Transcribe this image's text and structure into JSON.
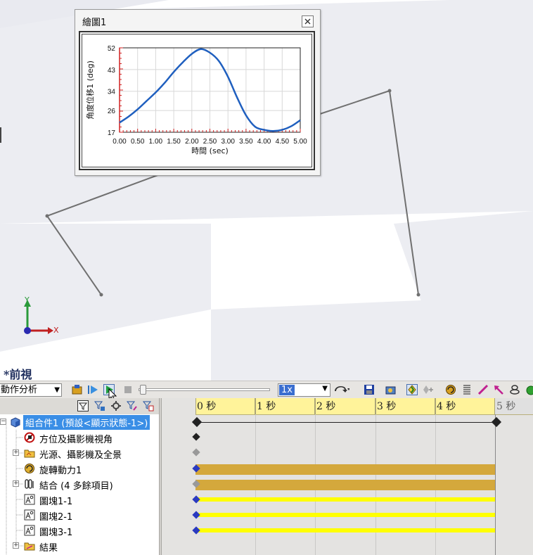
{
  "viewport": {
    "view_label": "*前視"
  },
  "triad": {
    "x_label": "X",
    "y_label": "Y"
  },
  "plot_window": {
    "title": "繪圖1",
    "close_icon": "close-icon"
  },
  "chart_data": {
    "type": "line",
    "title": "",
    "xlabel": "時間 (sec)",
    "ylabel": "角度位移1 (deg)",
    "xlim": [
      0,
      5
    ],
    "ylim": [
      17,
      52
    ],
    "x_ticks": [
      "0.00",
      "0.50",
      "1.00",
      "1.50",
      "2.00",
      "2.50",
      "3.00",
      "3.50",
      "4.00",
      "4.50",
      "5.00"
    ],
    "y_ticks": [
      "52",
      "43",
      "34",
      "26",
      "17"
    ],
    "grid": true,
    "series": [
      {
        "color": "#1f5fbf",
        "x": [
          0.0,
          0.25,
          0.5,
          0.75,
          1.0,
          1.25,
          1.5,
          1.75,
          2.0,
          2.25,
          2.5,
          2.75,
          3.0,
          3.25,
          3.5,
          3.75,
          4.0,
          4.25,
          4.5,
          4.75,
          5.0
        ],
        "y": [
          21,
          23.5,
          26.5,
          30,
          33.5,
          37.5,
          42,
          46,
          49.5,
          51.5,
          50,
          46.5,
          40,
          31.5,
          24,
          19.3,
          18,
          17.5,
          18,
          19.5,
          22
        ]
      }
    ]
  },
  "toolbar": {
    "study_type": "動作分析",
    "playback_speed": "1x"
  },
  "timeline": {
    "ticks": [
      "0 秒",
      "1 秒",
      "2 秒",
      "3 秒",
      "4 秒",
      "5 秒"
    ]
  },
  "tree": {
    "items": [
      {
        "label": "組合件1  (預設<顯示狀態-1>)",
        "icon": "assembly-icon"
      },
      {
        "label": "方位及攝影機視角",
        "icon": "orientation-camera-icon"
      },
      {
        "label": "光源、攝影機及全景",
        "icon": "lights-cameras-scene-icon"
      },
      {
        "label": "旋轉動力1",
        "icon": "rotary-motor-icon"
      },
      {
        "label": "結合 (4 多餘項目)",
        "icon": "mates-icon"
      },
      {
        "label": "圖塊1-1",
        "icon": "block-icon"
      },
      {
        "label": "圖塊2-1",
        "icon": "block-icon"
      },
      {
        "label": "圖塊3-1",
        "icon": "block-icon"
      },
      {
        "label": "結果",
        "icon": "results-icon"
      }
    ]
  },
  "colors": {
    "selection": "#3a8ee6",
    "timeline_ruler": "#fff39a",
    "motor_bar": "#d4a83c",
    "component_bar": "#ffff00"
  }
}
